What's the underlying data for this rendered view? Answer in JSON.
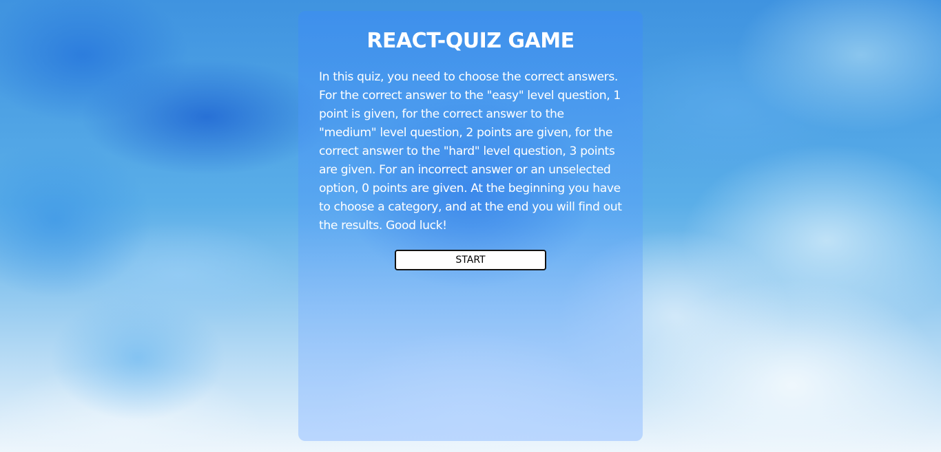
{
  "quiz": {
    "title": "REACT-QUIZ GAME",
    "description": "In this quiz, you need to choose the correct answers. For the correct answer to the \"easy\" level question, 1 point is given, for the correct answer to the \"medium\" level question, 2 points are given, for the correct answer to the \"hard\" level question, 3 points are given. For an incorrect answer or an unselected option, 0 points are given. At the beginning you have to choose a category, and at the end you will find out the results. Good luck!",
    "start_label": "START"
  },
  "colors": {
    "panel_tint": "#3c8cf5",
    "text": "#ffffff",
    "button_bg": "#ffffff",
    "button_border": "#111111"
  }
}
